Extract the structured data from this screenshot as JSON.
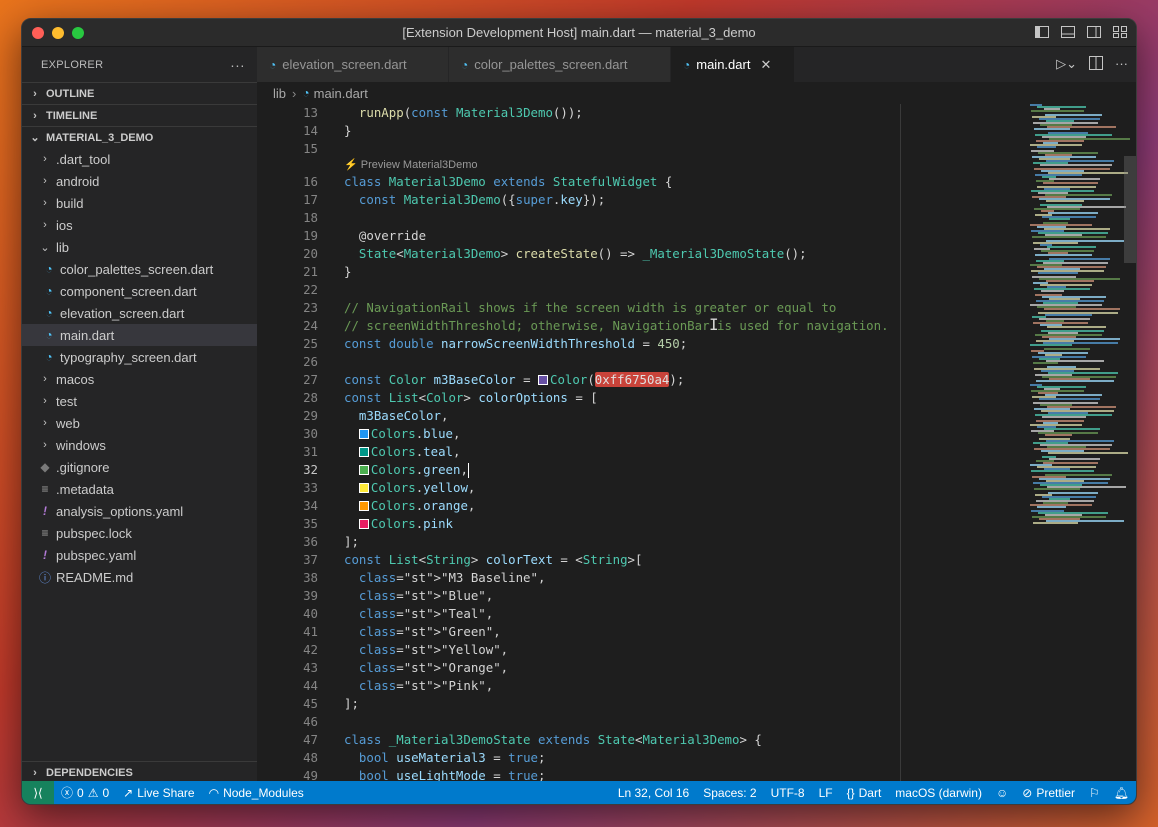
{
  "window": {
    "title": "[Extension Development Host] main.dart — material_3_demo"
  },
  "sidebar": {
    "header": "EXPLORER",
    "more": "···",
    "outline": "OUTLINE",
    "timeline": "TIMELINE",
    "project": "MATERIAL_3_DEMO",
    "items": [
      {
        "label": ".dart_tool",
        "type": "folder",
        "indent": 1
      },
      {
        "label": "android",
        "type": "folder",
        "indent": 1
      },
      {
        "label": "build",
        "type": "folder",
        "indent": 1
      },
      {
        "label": "ios",
        "type": "folder",
        "indent": 1
      },
      {
        "label": "lib",
        "type": "folder-open",
        "indent": 1
      },
      {
        "label": "color_palettes_screen.dart",
        "type": "dart",
        "indent": 2
      },
      {
        "label": "component_screen.dart",
        "type": "dart",
        "indent": 2
      },
      {
        "label": "elevation_screen.dart",
        "type": "dart",
        "indent": 2
      },
      {
        "label": "main.dart",
        "type": "dart",
        "indent": 2,
        "selected": true
      },
      {
        "label": "typography_screen.dart",
        "type": "dart",
        "indent": 2
      },
      {
        "label": "macos",
        "type": "folder",
        "indent": 1
      },
      {
        "label": "test",
        "type": "folder",
        "indent": 1
      },
      {
        "label": "web",
        "type": "folder",
        "indent": 1
      },
      {
        "label": "windows",
        "type": "folder",
        "indent": 1
      },
      {
        "label": ".gitignore",
        "type": "git",
        "indent": 1
      },
      {
        "label": ".metadata",
        "type": "meta",
        "indent": 1
      },
      {
        "label": "analysis_options.yaml",
        "type": "yaml",
        "indent": 1
      },
      {
        "label": "pubspec.lock",
        "type": "meta",
        "indent": 1
      },
      {
        "label": "pubspec.yaml",
        "type": "yaml",
        "indent": 1
      },
      {
        "label": "README.md",
        "type": "info",
        "indent": 1
      }
    ],
    "dependencies": "DEPENDENCIES"
  },
  "tabs": [
    {
      "label": "elevation_screen.dart",
      "active": false
    },
    {
      "label": "color_palettes_screen.dart",
      "active": false
    },
    {
      "label": "main.dart",
      "active": true
    }
  ],
  "breadcrumb": {
    "folder": "lib",
    "file": "main.dart"
  },
  "codelens": "⚡ Preview Material3Demo",
  "code_lines": [
    {
      "n": "13",
      "t": "  runApp(const Material3Demo());"
    },
    {
      "n": "14",
      "t": "}"
    },
    {
      "n": "15",
      "t": ""
    },
    {
      "n": "16",
      "t": "class Material3Demo extends StatefulWidget {"
    },
    {
      "n": "17",
      "t": "  const Material3Demo({super.key});"
    },
    {
      "n": "18",
      "t": ""
    },
    {
      "n": "19",
      "t": "  @override"
    },
    {
      "n": "20",
      "t": "  State<Material3Demo> createState() => _Material3DemoState();"
    },
    {
      "n": "21",
      "t": "}"
    },
    {
      "n": "22",
      "t": ""
    },
    {
      "n": "23",
      "t": "// NavigationRail shows if the screen width is greater or equal to"
    },
    {
      "n": "24",
      "t": "// screenWidthThreshold; otherwise, NavigationBar is used for navigation."
    },
    {
      "n": "25",
      "t": "const double narrowScreenWidthThreshold = 450;"
    },
    {
      "n": "26",
      "t": ""
    },
    {
      "n": "27",
      "t": "const Color m3BaseColor = Color(0xff6750a4);"
    },
    {
      "n": "28",
      "t": "const List<Color> colorOptions = ["
    },
    {
      "n": "29",
      "t": "  m3BaseColor,"
    },
    {
      "n": "30",
      "t": "  Colors.blue,"
    },
    {
      "n": "31",
      "t": "  Colors.teal,"
    },
    {
      "n": "32",
      "t": "  Colors.green,"
    },
    {
      "n": "33",
      "t": "  Colors.yellow,"
    },
    {
      "n": "34",
      "t": "  Colors.orange,"
    },
    {
      "n": "35",
      "t": "  Colors.pink"
    },
    {
      "n": "36",
      "t": "];"
    },
    {
      "n": "37",
      "t": "const List<String> colorText = <String>["
    },
    {
      "n": "38",
      "t": "  \"M3 Baseline\","
    },
    {
      "n": "39",
      "t": "  \"Blue\","
    },
    {
      "n": "40",
      "t": "  \"Teal\","
    },
    {
      "n": "41",
      "t": "  \"Green\","
    },
    {
      "n": "42",
      "t": "  \"Yellow\","
    },
    {
      "n": "43",
      "t": "  \"Orange\","
    },
    {
      "n": "44",
      "t": "  \"Pink\","
    },
    {
      "n": "45",
      "t": "];"
    },
    {
      "n": "46",
      "t": ""
    },
    {
      "n": "47",
      "t": "class _Material3DemoState extends State<Material3Demo> {"
    },
    {
      "n": "48",
      "t": "  bool useMaterial3 = true;"
    },
    {
      "n": "49",
      "t": "  bool useLightMode = true;"
    }
  ],
  "color_swatches": {
    "m3BaseColor": "#6750a4",
    "blue": "#2196f3",
    "teal": "#009688",
    "green": "#4caf50",
    "yellow": "#ffeb3b",
    "orange": "#ff9800",
    "pink": "#e91e63"
  },
  "statusbar": {
    "errors": "0",
    "warnings": "0",
    "live_share": "Live Share",
    "node_modules": "Node_Modules",
    "position": "Ln 32, Col 16",
    "spaces": "Spaces: 2",
    "encoding": "UTF-8",
    "eol": "LF",
    "language": "Dart",
    "platform": "macOS (darwin)",
    "prettier": "Prettier"
  },
  "colors": {
    "statusbar_bg": "#007acc",
    "remote_bg": "#16825d",
    "editor_bg": "#1e1e1e",
    "sidebar_bg": "#252526"
  }
}
